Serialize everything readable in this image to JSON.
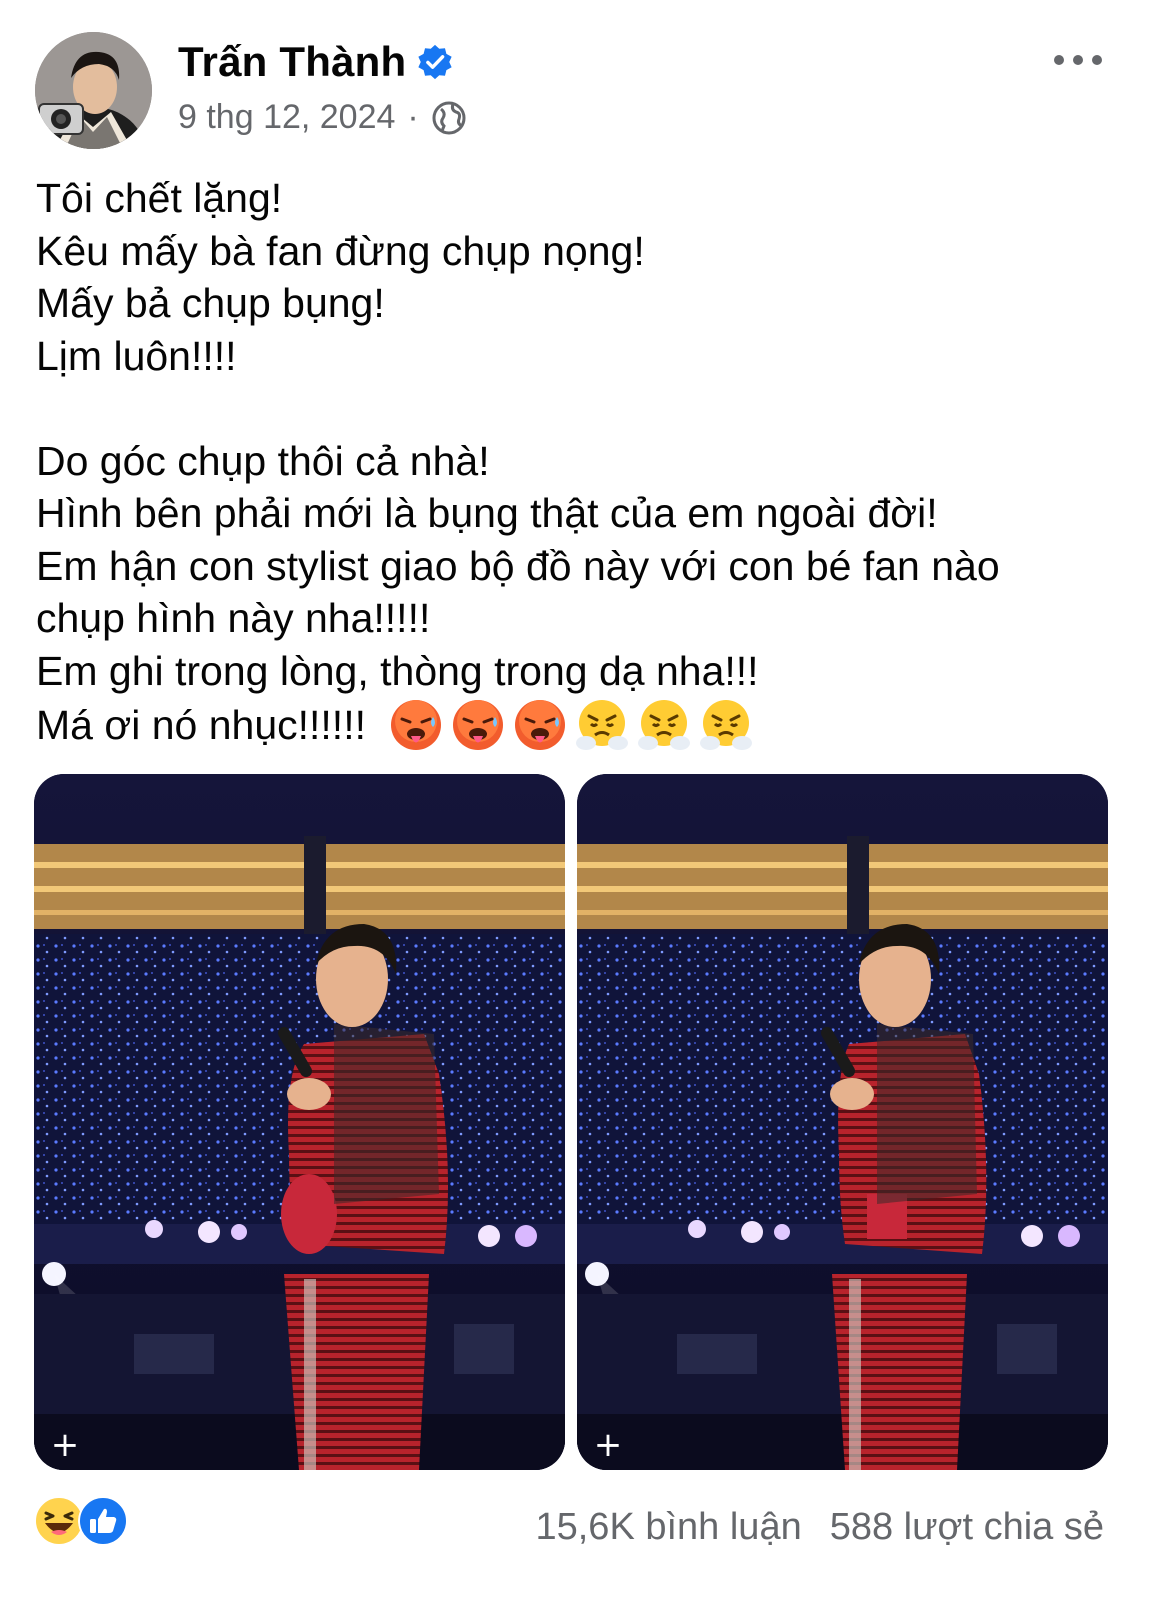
{
  "post": {
    "author": "Trấn Thành",
    "date": "9 thg 12, 2024",
    "separator": "·",
    "privacy_icon": "globe-icon",
    "verified_icon": "verified-badge-icon",
    "lines": [
      "Tôi chết lặng!",
      "Kêu mấy bà fan đừng chụp nọng!",
      "Mấy bả chụp bụng!",
      "Lịm luôn!!!!",
      "",
      "Do góc chụp thôi cả nhà!",
      "Hình bên phải mới là bụng thật của em ngoài đời!",
      "Em hận con stylist giao bộ đồ này với con bé fan nào",
      "chụp hình này nha!!!!!",
      "Em ghi trong lòng, thòng trong dạ nha!!!"
    ],
    "last_line_text": "Má ơi nó nhục!!!!!!",
    "last_line_emojis": [
      "hot-face-emoji",
      "hot-face-emoji",
      "hot-face-emoji",
      "steam-nose-emoji",
      "steam-nose-emoji",
      "steam-nose-emoji"
    ]
  },
  "photos": [
    {
      "name": "concert-photo-left",
      "badge": "+"
    },
    {
      "name": "concert-photo-right",
      "badge": "+"
    }
  ],
  "footer": {
    "reactions": [
      "haha-reaction-icon",
      "like-reaction-icon"
    ],
    "comments": "15,6K bình luận",
    "shares": "588 lượt chia sẻ"
  },
  "colors": {
    "verified": "#1877f2",
    "secondary_text": "#65676b",
    "text": "#050505"
  }
}
